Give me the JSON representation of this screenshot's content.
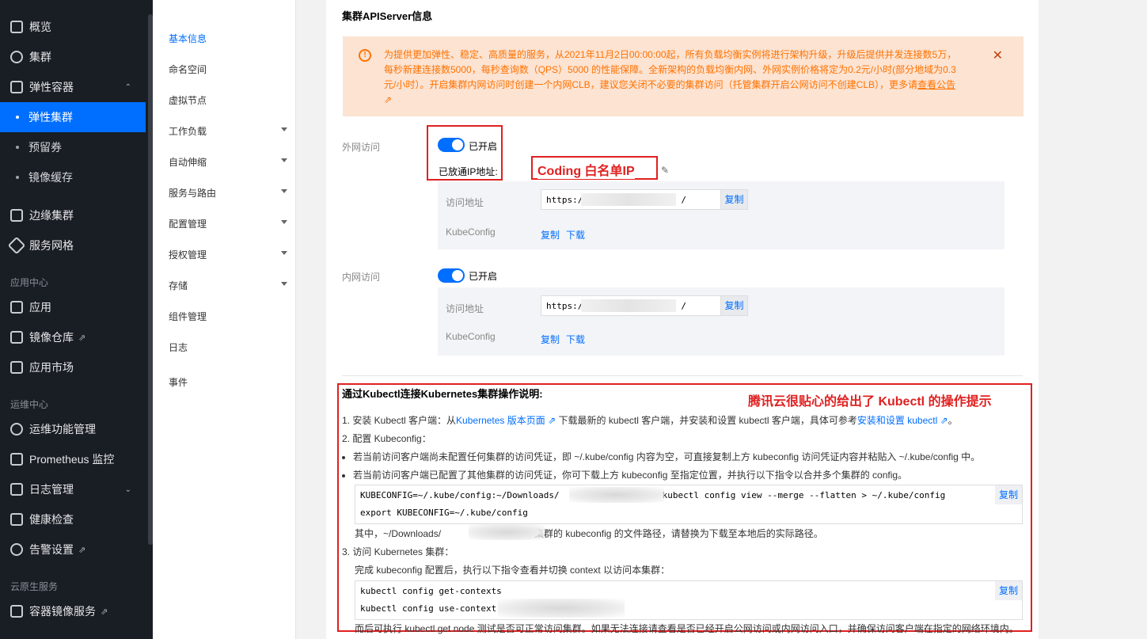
{
  "nav": {
    "items": [
      {
        "label": "概览",
        "icon": "grid-icon"
      },
      {
        "label": "集群",
        "icon": "cluster-icon"
      },
      {
        "label": "弹性容器",
        "icon": "container-icon"
      },
      {
        "label": "弹性集群",
        "sub": true,
        "active": true
      },
      {
        "label": "预留券",
        "sub": true
      },
      {
        "label": "镜像缓存",
        "sub": true
      },
      {
        "label": "边缘集群",
        "icon": "edge-icon"
      },
      {
        "label": "服务网格",
        "icon": "mesh-icon"
      }
    ],
    "section_app": "应用中心",
    "app_items": [
      {
        "label": "应用"
      },
      {
        "label": "镜像仓库"
      },
      {
        "label": "应用市场"
      }
    ],
    "section_ops": "运维中心",
    "ops_items": [
      {
        "label": "运维功能管理"
      },
      {
        "label": "Prometheus 监控"
      },
      {
        "label": "日志管理"
      },
      {
        "label": "健康检查"
      },
      {
        "label": "告警设置"
      }
    ],
    "section_cloud": "云原生服务",
    "cloud_items": [
      {
        "label": "容器镜像服务"
      }
    ]
  },
  "subnav": {
    "items": [
      "基本信息",
      "命名空间",
      "虚拟节点",
      "工作负载",
      "自动伸缩",
      "服务与路由",
      "配置管理",
      "授权管理",
      "存储",
      "组件管理",
      "日志",
      "事件"
    ]
  },
  "main": {
    "title": "集群APIServer信息",
    "notice": {
      "text": "为提供更加弹性、稳定、高质量的服务，从2021年11月2日00:00:00起，所有负载均衡实例将进行架构升级，升级后提供并发连接数5万，每秒新建连接数5000，每秒查询数（QPS）5000 的性能保障。全新架构的负载均衡内网、外网实例价格将定为0.2元/小时(部分地域为0.3元/小时）。开启集群内网访问时创建一个内网CLB，建议您关闭不必要的集群访问（托管集群开启公网访问不创建CLB），更多请",
      "link": "查看公告"
    },
    "external": {
      "label": "外网访问",
      "toggle": "已开启",
      "whitelist_label": "已放通IP地址:",
      "annotation": "Coding 白名单IP",
      "addr_label": "访问地址",
      "addr_prefix": "https:/",
      "addr_suffix": "/",
      "copy": "复制",
      "kube_label": "KubeConfig",
      "kube_copy": "复制",
      "kube_download": "下载"
    },
    "internal": {
      "label": "内网访问",
      "toggle": "已开启",
      "addr_label": "访问地址",
      "addr_prefix": "https:/",
      "addr_suffix": "/",
      "copy": "复制",
      "kube_label": "KubeConfig",
      "kube_copy": "复制",
      "kube_download": "下载"
    },
    "instructions": {
      "title": "通过Kubectl连接Kubernetes集群操作说明:",
      "annotation": "腾讯云很贴心的给出了 Kubectl 的操作提示",
      "step1_a": "1. 安装 Kubectl 客户端：从",
      "step1_link1": "Kubernetes 版本页面",
      "step1_b": "下载最新的 kubectl 客户端，并安装和设置 kubectl 客户端，具体可参考",
      "step1_link2": "安装和设置 kubectl",
      "step1_c": "。",
      "step2": "2. 配置 Kubeconfig：",
      "bullet1": "若当前访问客户端尚未配置任何集群的访问凭证，即 ~/.kube/config 内容为空，可直接复制上方 kubeconfig 访问凭证内容并粘贴入 ~/.kube/config 中。",
      "bullet2": "若当前访问客户端已配置了其他集群的访问凭证，你可下载上方 kubeconfig 至指定位置，并执行以下指令以合并多个集群的 config。",
      "code1_line1_a": "KUBECONFIG=~/.kube/config:~/Downloads/",
      "code1_line1_b": "kubectl config view --merge --flatten > ~/.kube/config",
      "code1_line2": "export KUBECONFIG=~/.kube/config",
      "code_copy": "复制",
      "note_a": "其中，~/Downloads/",
      "note_b": "为本集群的 kubeconfig 的文件路径，请替换为下载至本地后的实际路径。",
      "step3": "3. 访问 Kubernetes 集群：",
      "step3_desc": "完成 kubeconfig 配置后，执行以下指令查看并切换 context 以访问本集群：",
      "code2_line1": "kubectl config get-contexts",
      "code2_line2": "kubectl config use-context",
      "code2_copy": "复制",
      "footer": "而后可执行 kubectl get node 测试是否可正常访问集群。如果无法连接请查看是否已经开启公网访问或内网访问入口，并确保访问客户端在指定的网络环境内。"
    }
  }
}
